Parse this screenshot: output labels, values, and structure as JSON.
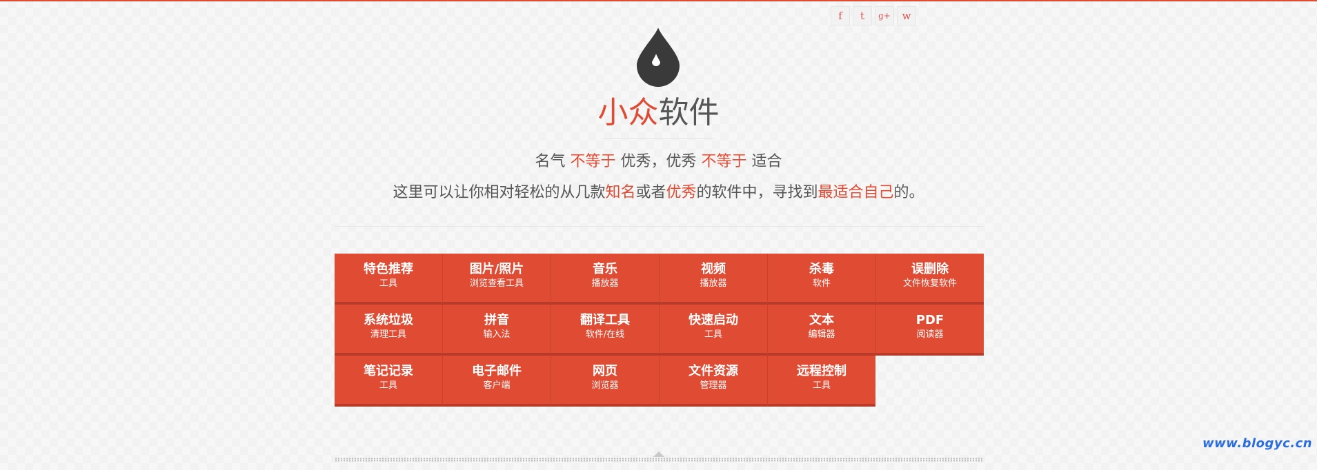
{
  "header": {
    "social": [
      {
        "icon": "facebook-icon",
        "glyph": "f"
      },
      {
        "icon": "twitter-icon",
        "glyph": "t"
      },
      {
        "icon": "googleplus-icon",
        "glyph": "g+"
      },
      {
        "icon": "weibo-icon",
        "glyph": "w"
      }
    ],
    "logo_icon": "droplet-icon",
    "title": {
      "accent": "小众",
      "rest": "软件"
    },
    "tagline": {
      "p1": "名气 ",
      "r1": "不等于",
      "p2": " 优秀，优秀 ",
      "r2": "不等于",
      "p3": " 适合"
    },
    "subline": {
      "p1": "这里可以让你相对轻松的从几款",
      "r1": "知名",
      "p2": "或者",
      "r2": "优秀",
      "p3": "的软件中，寻找到",
      "r3": "最适合自己",
      "p4": "的。"
    }
  },
  "categories": [
    {
      "title": "特色推荐",
      "subtitle": "工具"
    },
    {
      "title": "图片/照片",
      "subtitle": "浏览查看工具"
    },
    {
      "title": "音乐",
      "subtitle": "播放器"
    },
    {
      "title": "视频",
      "subtitle": "播放器"
    },
    {
      "title": "杀毒",
      "subtitle": "软件"
    },
    {
      "title": "误删除",
      "subtitle": "文件恢复软件"
    },
    {
      "title": "系统垃圾",
      "subtitle": "清理工具"
    },
    {
      "title": "拼音",
      "subtitle": "输入法"
    },
    {
      "title": "翻译工具",
      "subtitle": "软件/在线"
    },
    {
      "title": "快速启动",
      "subtitle": "工具"
    },
    {
      "title": "文本",
      "subtitle": "编辑器"
    },
    {
      "title": "PDF",
      "subtitle": "阅读器"
    },
    {
      "title": "笔记记录",
      "subtitle": "工具"
    },
    {
      "title": "电子邮件",
      "subtitle": "客户端"
    },
    {
      "title": "网页",
      "subtitle": "浏览器"
    },
    {
      "title": "文件资源",
      "subtitle": "管理器"
    },
    {
      "title": "远程控制",
      "subtitle": "工具"
    }
  ],
  "colors": {
    "accent": "#e04b33",
    "tile_shadow": "#b83a28",
    "text": "#555555",
    "watermark": "#2a6de0"
  },
  "watermark": "www.blogyc.cn"
}
